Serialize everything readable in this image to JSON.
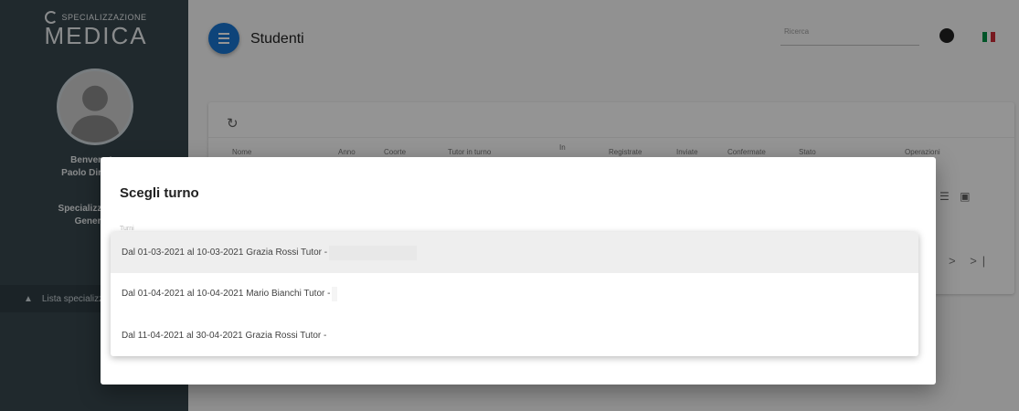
{
  "brand": {
    "top": "SPECIALIZZAZIONE",
    "main": "MEDICA"
  },
  "sidebar": {
    "welcome_lines": [
      "Benvenuto",
      "Paolo Direttore",
      "",
      "Specializzazione",
      "Generale"
    ],
    "nav_item_label": "Lista specializzazioni"
  },
  "header": {
    "title": "Studenti",
    "search_placeholder": "Ricerca"
  },
  "table": {
    "headers": [
      "Nome",
      "Anno",
      "Coorte",
      "Tutor in turno",
      "In",
      "Registrate",
      "Inviate",
      "Confermate",
      "Stato",
      "Operazioni"
    ]
  },
  "pager": {
    "symbols": "> >|"
  },
  "dialog": {
    "title": "Scegli turno",
    "label": "Turni",
    "options": [
      "Dal 01-03-2021 al 10-03-2021 Grazia Rossi Tutor -",
      "Dal 01-04-2021 al 10-04-2021 Mario Bianchi Tutor -",
      "Dal 11-04-2021 al 30-04-2021 Grazia Rossi Tutor -"
    ]
  },
  "colors": {
    "accent": "#1976d2",
    "sidebar": "#37474f"
  }
}
